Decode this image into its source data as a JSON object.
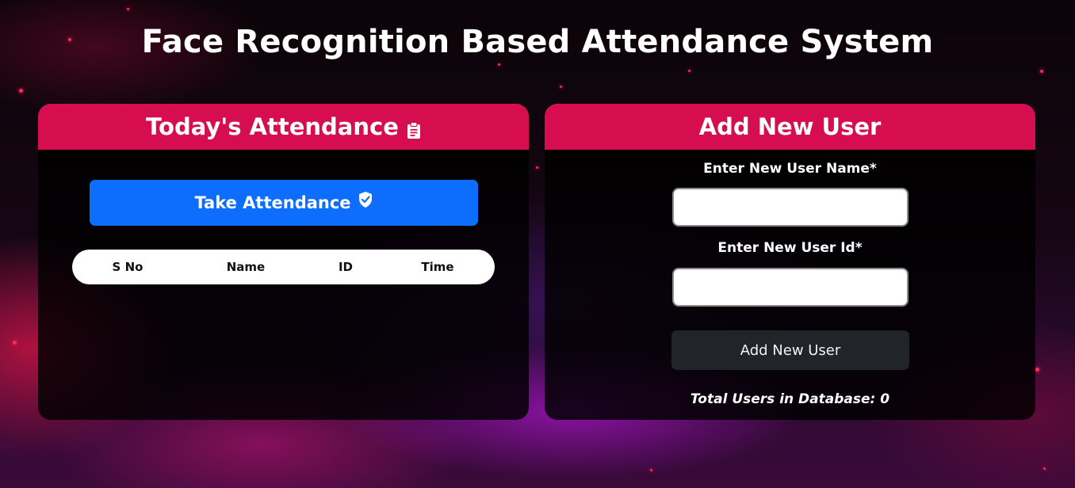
{
  "page": {
    "title": "Face Recognition Based Attendance System"
  },
  "attendance_panel": {
    "header": "Today's Attendance",
    "header_icon": "clipboard-icon",
    "take_button_label": "Take Attendance",
    "take_button_icon": "shield-check-icon",
    "table_columns": [
      "S No",
      "Name",
      "ID",
      "Time"
    ],
    "rows": []
  },
  "add_user_panel": {
    "header": "Add New User",
    "name_label": "Enter New User Name*",
    "name_value": "",
    "id_label": "Enter New User Id*",
    "id_value": "",
    "submit_label": "Add New User",
    "total_users_text": "Total Users in Database: 0"
  },
  "colors": {
    "panel_header": "#d60e4f",
    "primary_button": "#0d6efd",
    "dark_button": "#212529",
    "panel_background": "#000000"
  }
}
